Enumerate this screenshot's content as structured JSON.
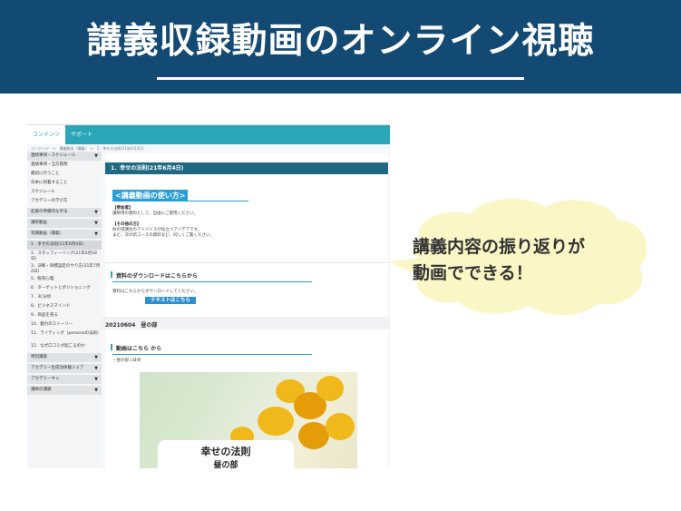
{
  "banner": {
    "title": "講義収録動画のオンライン視聴",
    "bg": "#134a74"
  },
  "bubble": {
    "line1": "講義内容の振り返りが",
    "line2": "動画でできる！"
  },
  "screenshot": {
    "nav": {
      "tabs": [
        "コンテンツ",
        "サポート"
      ]
    },
    "breadcrumb": "コンテンツ　>　講義動画（講義）　>　1．幸せの法則(21年6月4日)",
    "sidebar": {
      "items": [
        {
          "type": "head",
          "label": "連絡事項・スケジュール"
        },
        {
          "type": "item",
          "label": "連絡事項・当方質問"
        },
        {
          "type": "item",
          "label": "最初に行うこと"
        },
        {
          "type": "item",
          "label": "日本に到着すること"
        },
        {
          "type": "item",
          "label": "スケジュール"
        },
        {
          "type": "item",
          "label": "アカデミーの学び方"
        },
        {
          "type": "head",
          "label": "起業の準備的な手法"
        },
        {
          "type": "head",
          "label": "講師動画"
        },
        {
          "type": "head",
          "label": "受講動画（講義）"
        },
        {
          "type": "sel",
          "label": "1．幸せの法則(21年6月4日)"
        },
        {
          "type": "item",
          "label": "2．スタッフィーリング(21年6月18日)"
        },
        {
          "type": "item",
          "label": "3．決断・目標設定のやり方(21年7月2日)"
        },
        {
          "type": "item",
          "label": "5．販売心理"
        },
        {
          "type": "item",
          "label": "6．ターゲットとポジショニング"
        },
        {
          "type": "item",
          "label": "7．3C分析"
        },
        {
          "type": "item",
          "label": "8．ビジネスマインド"
        },
        {
          "type": "item",
          "label": "9．商品を売る"
        },
        {
          "type": "item",
          "label": "10．魅力のストーリー"
        },
        {
          "type": "item",
          "label": "11．ライティング（personaの法則）"
        },
        {
          "type": "item",
          "label": "12．なぜ口コミが起こるのか"
        },
        {
          "type": "head",
          "label": "特別講座"
        },
        {
          "type": "head",
          "label": "アカデミー生成功体験シェア"
        },
        {
          "type": "head",
          "label": "アカデミーキャ"
        },
        {
          "type": "head",
          "label": "講師の課題"
        }
      ]
    },
    "main": {
      "page_heading": "1．幸せの法則(21年6月4日)",
      "howto_title": "<講義動画の使い方>",
      "howto_label1": "【参加者】",
      "howto_text1": "講師用の資料として、自由にご使用ください。",
      "howto_label2": "【その他の方】",
      "howto_text2a": "他の受講生のアドバイスが役立つアイデアです。",
      "howto_text2b": "また、次の新コースの資料など、同じくご覧ください。",
      "download_title": "資料のダウンロードはこちらから",
      "download_text": "資料はこちらからダウンロードしてください。",
      "text_button": "テキストはこちら",
      "date_section": "20210604　昼の部",
      "video_title": "動画はこちら から",
      "video_sub": "・昼の部 1日目",
      "card_title": "幸せの法則",
      "card_sub": "昼の部"
    }
  }
}
